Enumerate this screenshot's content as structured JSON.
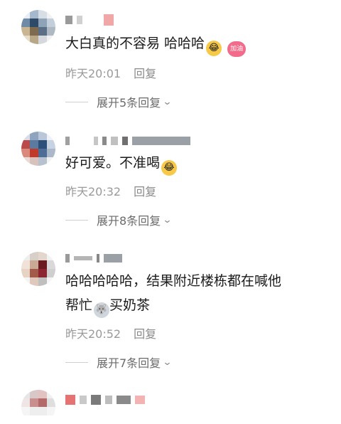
{
  "comments": [
    {
      "text": "大白真的不容易 哈哈哈",
      "emoji_1": "laughing-crying-icon",
      "emoji_2": "jiayou-heart-sticker",
      "emoji_2_text": "加油",
      "time": "昨天20:01",
      "reply": "回复",
      "expand": "展开5条回复"
    },
    {
      "text": "好可爱。不准喝",
      "emoji_1": "laughing-crying-icon",
      "time": "昨天20:32",
      "reply": "回复",
      "expand": "展开8条回复"
    },
    {
      "text_line1": "哈哈哈哈哈，结果附近楼栋都在喊他",
      "text_line2a": "帮忙",
      "emoji_1": "husky-dog-icon",
      "text_line2b": "买奶茶",
      "time": "昨天20:52",
      "reply": "回复",
      "expand": "展开7条回复"
    }
  ],
  "colors": {
    "meta": "#9a9a9a",
    "text": "#1a1a1a",
    "expand": "#6b6b6b"
  }
}
